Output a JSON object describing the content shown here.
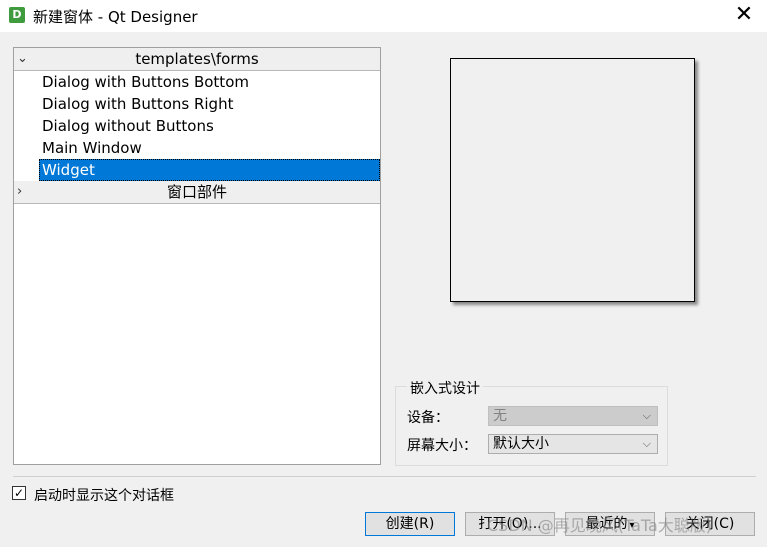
{
  "window": {
    "title": "新建窗体 - Qt Designer",
    "icon_letter": "D",
    "close_glyph": "✕"
  },
  "tree": {
    "groups": [
      {
        "label": "templates\\forms",
        "expanded": true,
        "chevron": "⌄",
        "items": [
          {
            "label": "Dialog with Buttons Bottom"
          },
          {
            "label": "Dialog with Buttons Right"
          },
          {
            "label": "Dialog without Buttons"
          },
          {
            "label": "Main Window"
          },
          {
            "label": "Widget",
            "selected": true
          }
        ]
      },
      {
        "label": "窗口部件",
        "expanded": false,
        "chevron": "›"
      }
    ]
  },
  "embedded": {
    "title": "嵌入式设计",
    "device_label": "设备：",
    "device_value": "无",
    "screen_size_label": "屏幕大小：",
    "screen_size_value": "默认大小",
    "arrow_glyph": "⌵"
  },
  "startup": {
    "checked": true,
    "check_glyph": "✓",
    "label": "启动时显示这个对话框"
  },
  "buttons": {
    "create": "创建(R)",
    "open": "打开(O)...",
    "recent": "最近的",
    "recent_arrow": "▾",
    "close": "关闭(C)"
  },
  "watermark": "CSDN @再见晚风(TaTa大聪版)",
  "colors": {
    "selection": "#0078d7",
    "app_icon": "#3e9b3e"
  }
}
